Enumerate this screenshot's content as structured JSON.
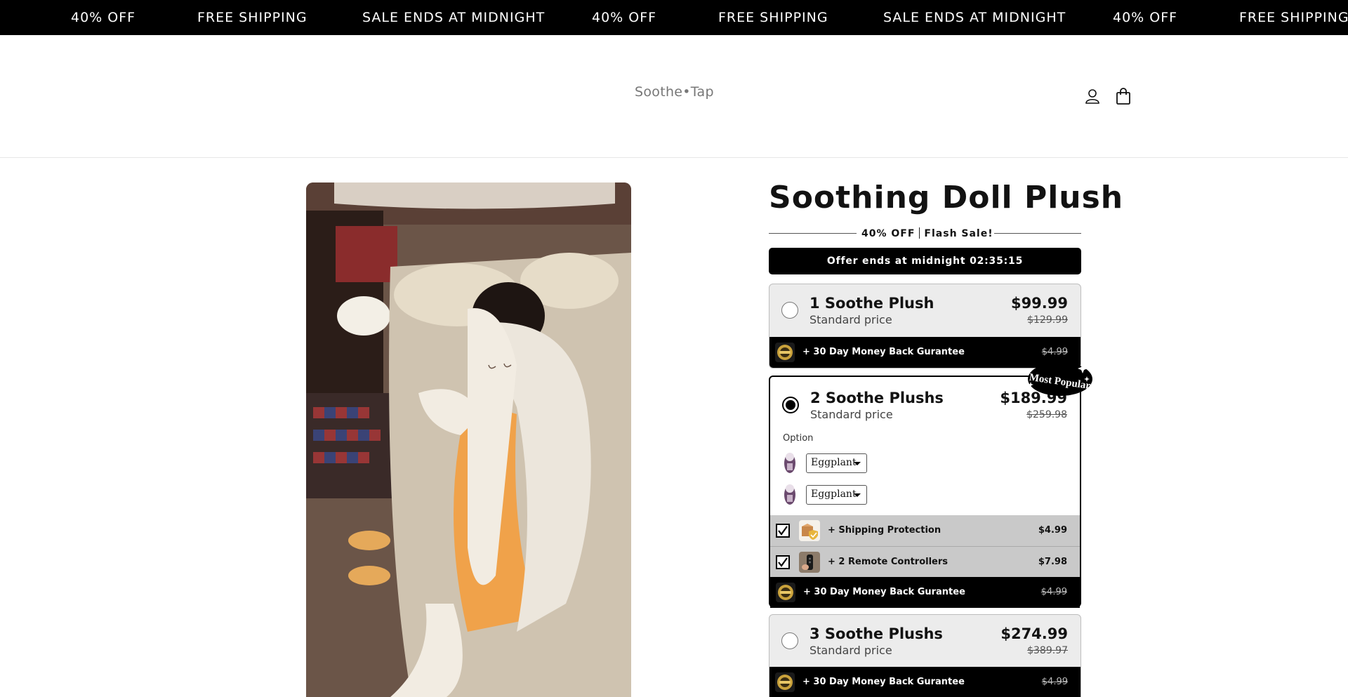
{
  "announcement": {
    "items": [
      "40% OFF",
      "FREE SHIPPING",
      "SALE ENDS AT MIDNIGHT",
      "40% OFF",
      "FREE SHIPPING",
      "SALE ENDS AT MIDNIGHT",
      "40% OFF",
      "FREE SHIPPING"
    ]
  },
  "header": {
    "logo_text": "Soothe•Tap",
    "icons": [
      "account-icon",
      "cart-icon"
    ]
  },
  "product": {
    "title": "Soothing Doll Plush",
    "discount_text": "40% OFF",
    "flash_text": "Flash Sale!",
    "timer_label": "Offer ends at midnight",
    "timer_value": "02:35:15",
    "bundles": [
      {
        "name": "1 Soothe Plush",
        "subtitle": "Standard price",
        "price": "$99.99",
        "compare_price": "$129.99",
        "selected": false,
        "guarantee_label": "+ 30 Day Money Back Gurantee",
        "guarantee_price": "$4.99"
      },
      {
        "name": "2 Soothe Plushs",
        "subtitle": "Standard price",
        "price": "$189.99",
        "compare_price": "$259.98",
        "selected": true,
        "badge": "Most Popular",
        "option_label": "Option",
        "variants": [
          "Eggplant",
          "Eggplant"
        ],
        "addons": [
          {
            "label": "+ Shipping Protection",
            "price": "$4.99",
            "checked": true,
            "icon": "package-shield-icon"
          },
          {
            "label": "+ 2 Remote Controllers",
            "price": "$7.98",
            "checked": true,
            "icon": "remote-controller-icon"
          }
        ],
        "guarantee_label": "+ 30 Day Money Back Gurantee",
        "guarantee_price": "$4.99"
      },
      {
        "name": "3 Soothe Plushs",
        "subtitle": "Standard price",
        "price": "$274.99",
        "compare_price": "$389.97",
        "selected": false,
        "guarantee_label": "+ 30 Day Money Back Gurantee",
        "guarantee_price": "$4.99"
      }
    ]
  },
  "colors": {
    "black": "#000000",
    "card_bg": "#ececec",
    "addon_gray": "#c9c9c9",
    "logo_gray": "#777777"
  }
}
